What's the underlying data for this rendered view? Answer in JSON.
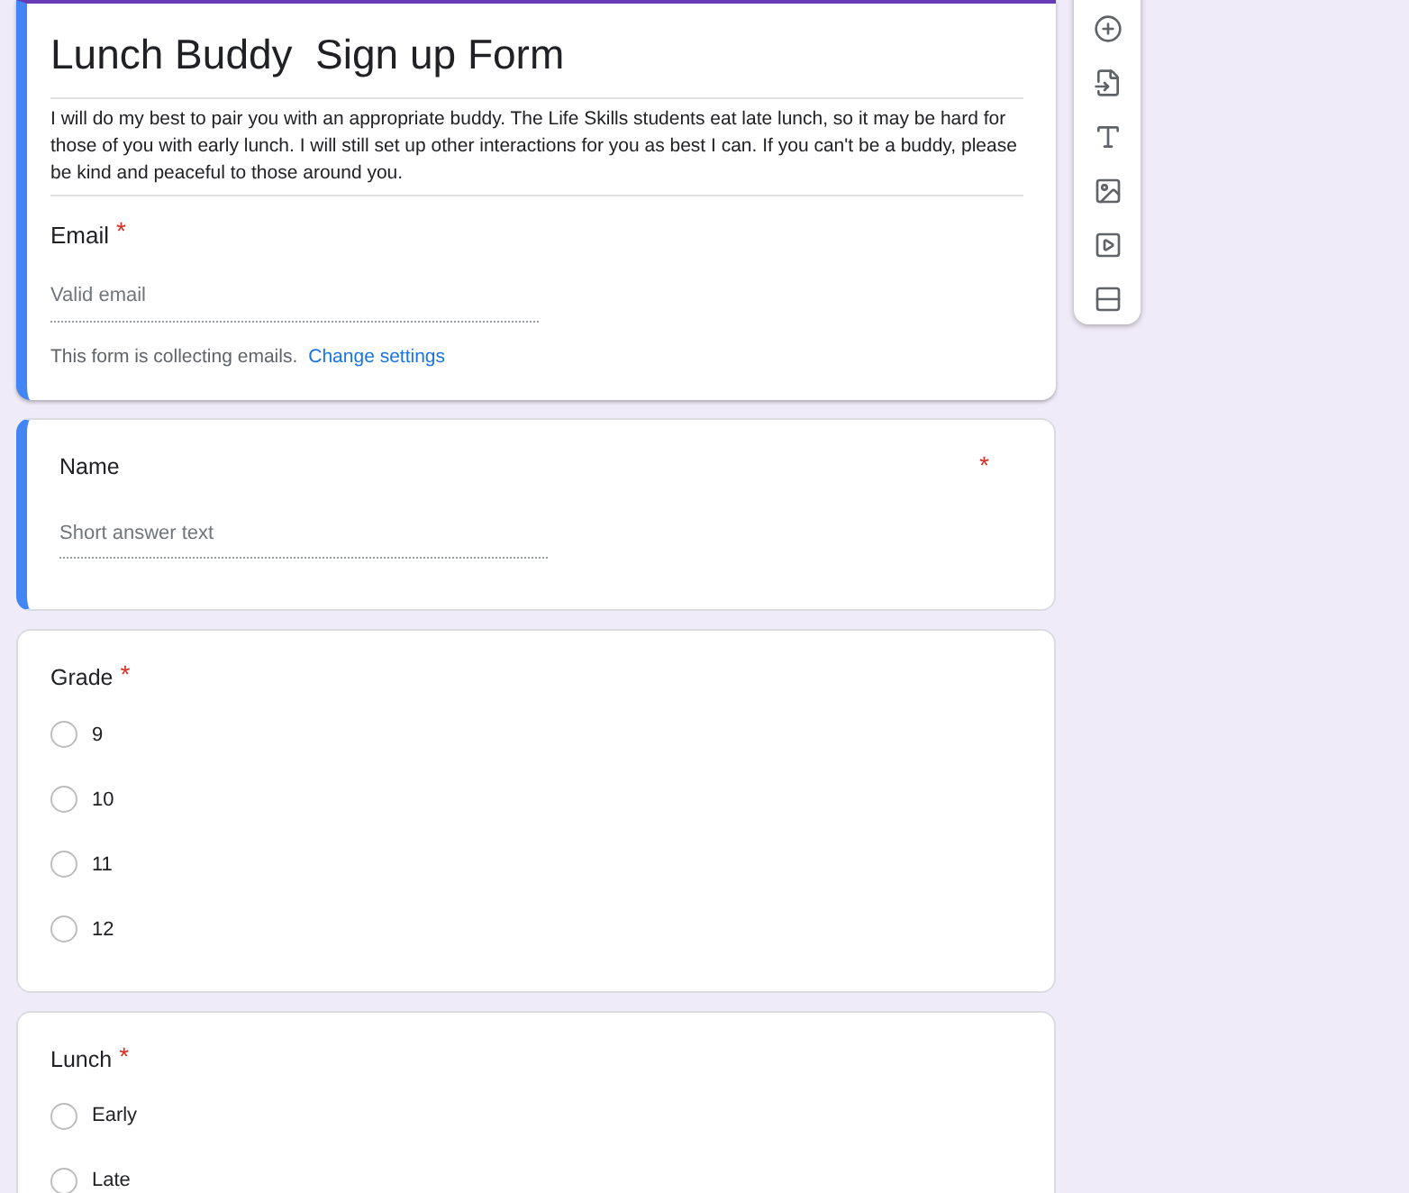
{
  "form": {
    "title": "Lunch Buddy  Sign up Form",
    "description": "I will do my best to pair you with an appropriate buddy. The Life Skills students eat late lunch, so it may be hard for those of you with early lunch. I will still set up other interactions for you as best I can. If you can't be a buddy, please be kind and peaceful to those around you.",
    "email": {
      "label": "Email",
      "required_mark": "*",
      "placeholder": "Valid email"
    },
    "notice": "This form is collecting emails.",
    "notice_link": "Change settings"
  },
  "questions": [
    {
      "kind": "short",
      "title": "Name",
      "required_mark": "*",
      "selected": true,
      "placeholder": "Short answer text"
    },
    {
      "kind": "choice",
      "title": "Grade",
      "required_mark": "*",
      "selected": false,
      "options": [
        {
          "label": "9",
          "selected": false
        },
        {
          "label": "10",
          "selected": false
        },
        {
          "label": "11",
          "selected": false
        },
        {
          "label": "12",
          "selected": false
        }
      ]
    },
    {
      "kind": "choice",
      "title": "Lunch",
      "required_mark": "*",
      "selected": false,
      "options": [
        {
          "label": "Early",
          "selected": false
        },
        {
          "label": "Late",
          "selected": false
        }
      ]
    }
  ]
}
